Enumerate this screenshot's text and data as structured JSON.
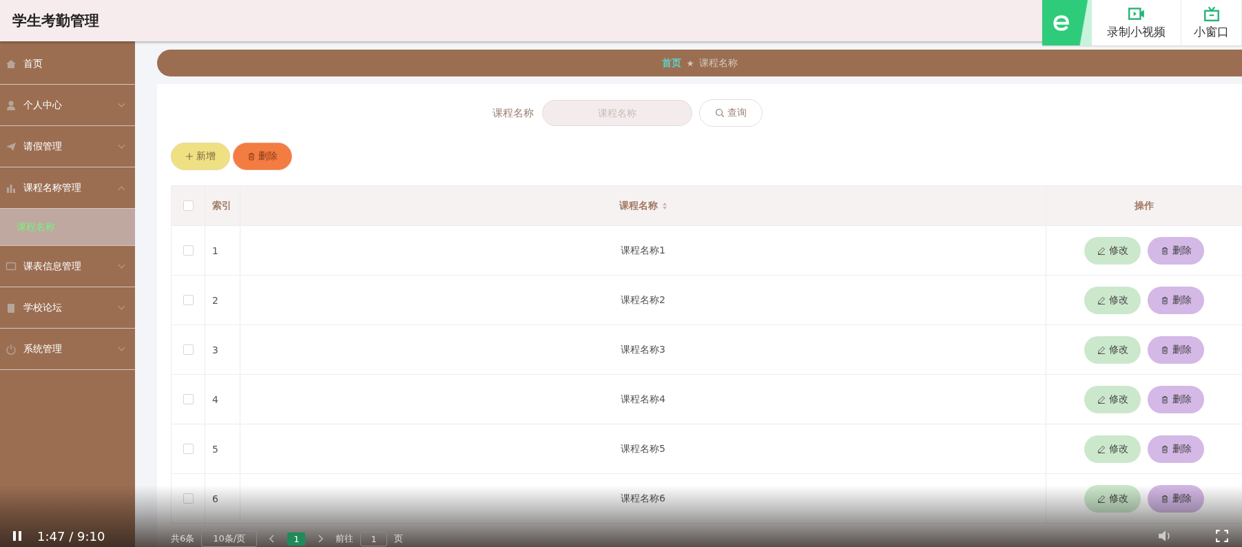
{
  "app_title": "学生考勤管理",
  "player_overlay": {
    "record_label": "录制小视频",
    "mini_window_label": "小窗口",
    "time": "1:47 / 9:10",
    "playing": true
  },
  "sidebar": {
    "items": [
      {
        "label": "首页",
        "kind": "link"
      },
      {
        "label": "个人中心",
        "kind": "menu",
        "expanded": false
      },
      {
        "label": "请假管理",
        "kind": "menu",
        "expanded": false
      },
      {
        "label": "课程名称管理",
        "kind": "menu",
        "expanded": true,
        "children": [
          {
            "label": "课程名称",
            "selected": true
          }
        ]
      },
      {
        "label": "课表信息管理",
        "kind": "menu",
        "expanded": false
      },
      {
        "label": "学校论坛",
        "kind": "menu",
        "expanded": false
      },
      {
        "label": "系统管理",
        "kind": "menu",
        "expanded": false
      }
    ]
  },
  "breadcrumb": [
    {
      "label": "首页",
      "current": false
    },
    {
      "label": "课程名称",
      "current": true
    }
  ],
  "search": {
    "label": "课程名称",
    "placeholder": "课程名称",
    "button": "查询"
  },
  "actions": {
    "add": "新增",
    "delete": "删除"
  },
  "table": {
    "columns": [
      {
        "label": "索引",
        "sortable": false
      },
      {
        "label": "课程名称",
        "sortable": true
      },
      {
        "label": "操作",
        "sortable": false
      }
    ],
    "header_checked": false,
    "rows": [
      {
        "index": "1",
        "name": "课程名称1",
        "checked": false,
        "edit": "修改",
        "delete": "删除"
      },
      {
        "index": "2",
        "name": "课程名称2",
        "checked": false,
        "edit": "修改",
        "delete": "删除"
      },
      {
        "index": "3",
        "name": "课程名称3",
        "checked": false,
        "edit": "修改",
        "delete": "删除"
      },
      {
        "index": "4",
        "name": "课程名称4",
        "checked": false,
        "edit": "修改",
        "delete": "删除"
      },
      {
        "index": "5",
        "name": "课程名称5",
        "checked": false,
        "edit": "修改",
        "delete": "删除"
      },
      {
        "index": "6",
        "name": "课程名称6",
        "checked": false,
        "edit": "修改",
        "delete": "删除"
      }
    ]
  },
  "pagination": {
    "total": "共6条",
    "page_size": "10条/页",
    "pages": [
      {
        "label": "1",
        "selected": true
      }
    ],
    "goto_label": "前往",
    "goto_value": "1",
    "page_suffix": "页"
  }
}
